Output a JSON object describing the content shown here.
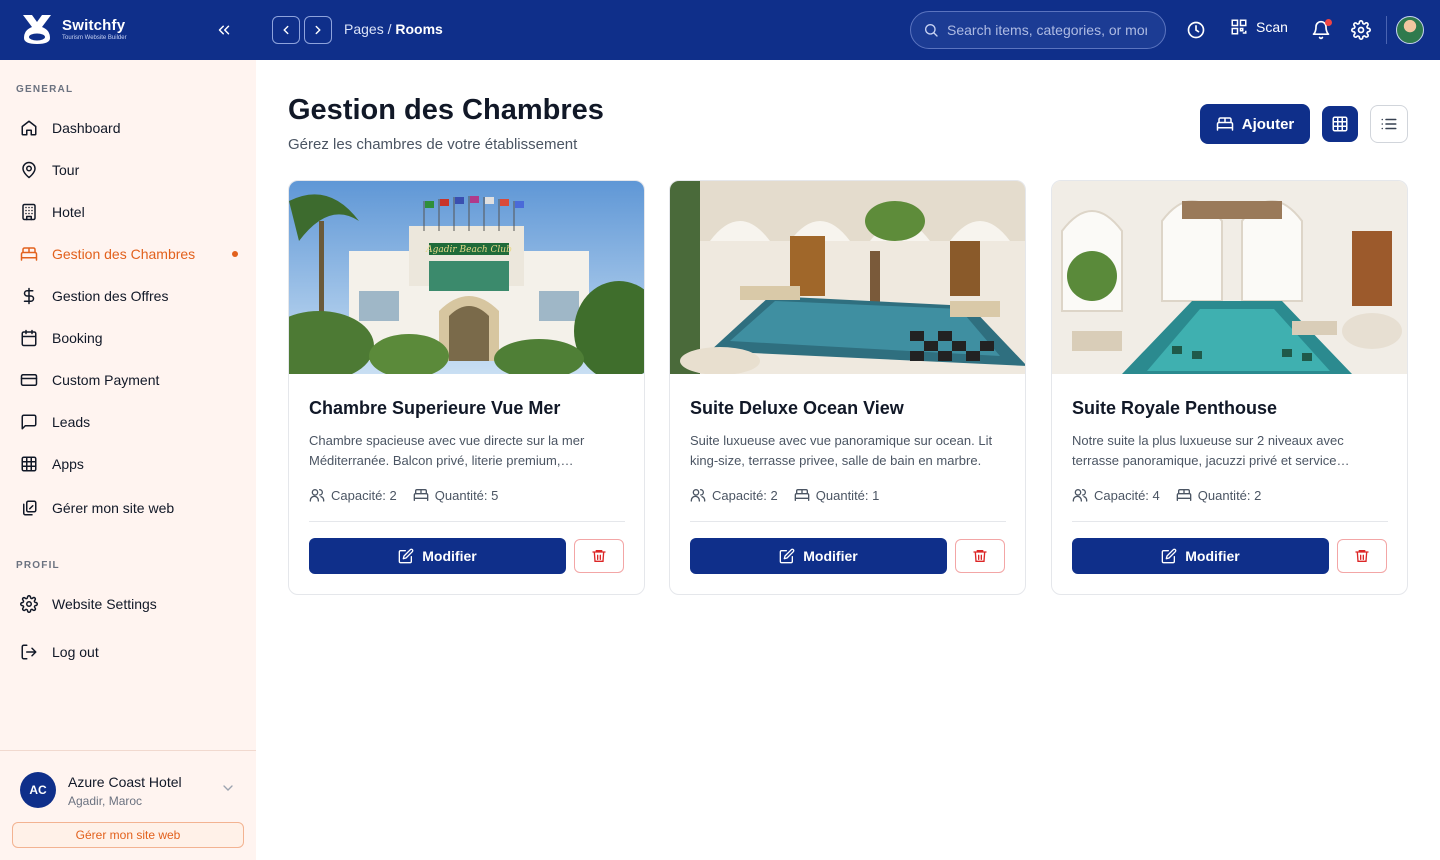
{
  "brand": {
    "name": "Switchfy",
    "tagline": "Tourism Website Builder"
  },
  "topbar": {
    "breadcrumb_parent": "Pages /",
    "breadcrumb_current": "Rooms",
    "search_placeholder": "Search items, categories, or more",
    "scan_label": "Scan"
  },
  "sidebar": {
    "general_label": "GENERAL",
    "items": [
      {
        "label": "Dashboard",
        "icon": "home-icon"
      },
      {
        "label": "Tour",
        "icon": "map-pin-icon"
      },
      {
        "label": "Hotel",
        "icon": "building-icon"
      },
      {
        "label": "Gestion des Chambres",
        "icon": "bed-icon",
        "active": true
      },
      {
        "label": "Gestion des Offres",
        "icon": "dollar-icon"
      },
      {
        "label": "Booking",
        "icon": "calendar-icon"
      },
      {
        "label": "Custom Payment",
        "icon": "credit-card-icon"
      },
      {
        "label": "Leads",
        "icon": "message-square-icon"
      },
      {
        "label": "Apps",
        "icon": "grid-icon"
      },
      {
        "label": "Gérer mon site web",
        "icon": "copy-icon"
      }
    ],
    "profil_label": "PROFIL",
    "profil_items": [
      {
        "label": "Website Settings",
        "icon": "gear-icon"
      },
      {
        "label": "Log out",
        "icon": "logout-icon"
      }
    ],
    "hotel": {
      "initials": "AC",
      "name": "Azure Coast Hotel",
      "location": "Agadir, Maroc"
    },
    "site_button": "Gérer mon site web"
  },
  "main": {
    "title": "Gestion des Chambres",
    "subtitle": "Gérez les chambres de votre établissement",
    "add_label": "Ajouter",
    "rooms": [
      {
        "title": "Chambre Superieure Vue Mer",
        "description": "Chambre spacieuse avec vue directe sur la mer Méditerranée. Balcon privé, literie premium, climatisation et minibar.",
        "capacity": "Capacité: 2",
        "quantity": "Quantité: 5",
        "edit_label": "Modifier",
        "image_sign": "Agadir Beach Club"
      },
      {
        "title": "Suite Deluxe Ocean View",
        "description": "Suite luxueuse avec vue panoramique sur ocean. Lit king-size, terrasse privee, salle de bain en marbre.",
        "capacity": "Capacité: 2",
        "quantity": "Quantité: 1",
        "edit_label": "Modifier"
      },
      {
        "title": "Suite Royale Penthouse",
        "description": "Notre suite la plus luxueuse sur 2 niveaux avec terrasse panoramique, jacuzzi privé et service majordome.",
        "capacity": "Capacité: 4",
        "quantity": "Quantité: 2",
        "edit_label": "Modifier"
      }
    ]
  },
  "colors": {
    "primary": "#0f2f8a",
    "accent": "#e2611d",
    "danger": "#dc2626",
    "sidebar_bg": "#fff4f0"
  }
}
